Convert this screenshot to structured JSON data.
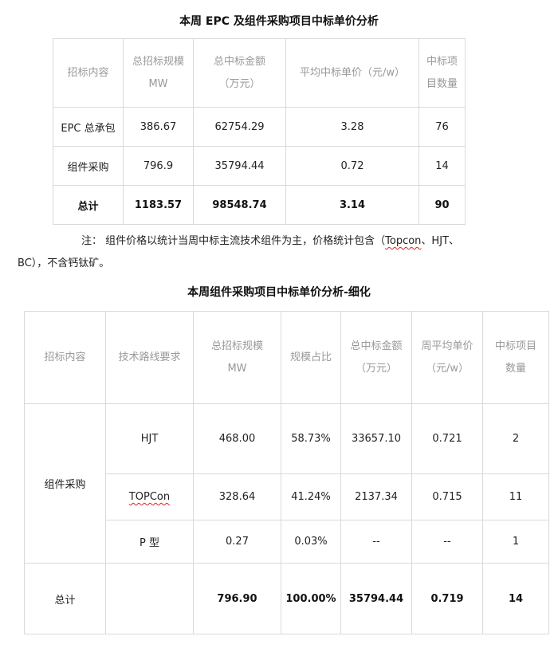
{
  "table1": {
    "title": "本周 EPC 及组件采购项目中标单价分析",
    "headers": [
      "招标内容",
      "总招标规模 MW",
      "总中标金额（万元）",
      "平均中标单价（元/w）",
      "中标项目数量"
    ],
    "header_lines": [
      [
        "招标内容"
      ],
      [
        "总招标规模",
        "MW"
      ],
      [
        "总中标金额",
        "（万元）"
      ],
      [
        "平均中标单价（元/w）"
      ],
      [
        "中标项",
        "目数量"
      ]
    ],
    "rows": [
      [
        "EPC 总承包",
        "386.67",
        "62754.29",
        "3.28",
        "76"
      ],
      [
        "组件采购",
        "796.9",
        "35794.44",
        "0.72",
        "14"
      ],
      [
        "总计",
        "1183.57",
        "98548.74",
        "3.14",
        "90"
      ]
    ]
  },
  "note": {
    "prefix": "注：  组件价格以统计当周中标主流技术组件为主，价格统计包含（",
    "term1": "Topcon",
    "middle": "、HJT、",
    "line2": "BC），不含钙钛矿。"
  },
  "table2": {
    "title": "本周组件采购项目中标单价分析-细化",
    "headers": [
      "招标内容",
      "技术路线要求",
      "总招标规模 MW",
      "规模占比",
      "总中标金额（万元）",
      "周平均单价（元/w）",
      "中标项目数量"
    ],
    "header_lines": [
      [
        "招标内容"
      ],
      [
        "技术路线要求"
      ],
      [
        "总招标规模",
        "MW"
      ],
      [
        "规模占比"
      ],
      [
        "总中标金额",
        "（万元）"
      ],
      [
        "周平均单价",
        "（元/w）"
      ],
      [
        "中标项目",
        "数量"
      ]
    ],
    "group_label": "组件采购",
    "rows": [
      [
        "HJT",
        "468.00",
        "58.73%",
        "33657.10",
        "0.721",
        "2"
      ],
      [
        "TOPCon",
        "328.64",
        "41.24%",
        "2137.34",
        "0.715",
        "11"
      ],
      [
        "P 型",
        "0.27",
        "0.03%",
        "--",
        "--",
        "1"
      ]
    ],
    "total": [
      "总计",
      "",
      "796.90",
      "100.00%",
      "35794.44",
      "0.719",
      "14"
    ]
  }
}
